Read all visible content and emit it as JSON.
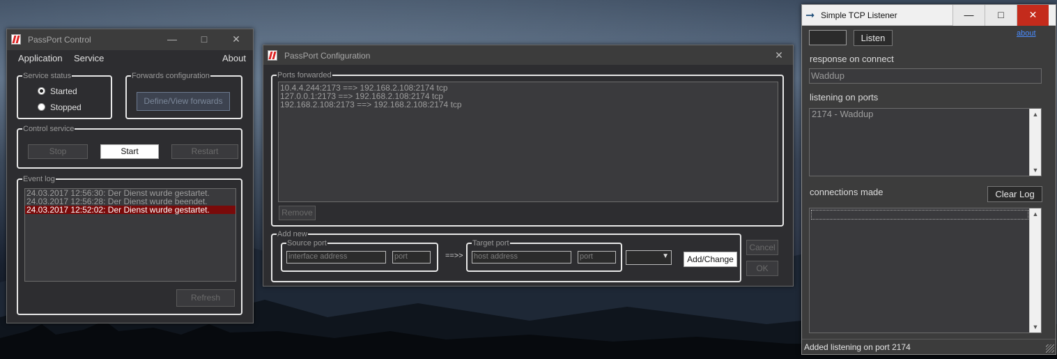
{
  "passport_control": {
    "title": "PassPort Control",
    "menu": {
      "application": "Application",
      "service": "Service",
      "about": "About"
    },
    "service_status": {
      "legend": "Service status",
      "started": "Started",
      "stopped": "Stopped",
      "selected": "Started"
    },
    "forwards_configuration": {
      "legend": "Forwards configuration",
      "button": "Define/View forwards"
    },
    "control_service": {
      "legend": "Control service",
      "stop": "Stop",
      "start": "Start",
      "restart": "Restart"
    },
    "event_log": {
      "legend": "Event log",
      "entries": [
        "24.03.2017 12:56:30:  Der Dienst wurde gestartet.",
        "24.03.2017 12:56:28:  Der Dienst wurde beendet.",
        "24.03.2017 12:52:02:  Der Dienst wurde gestartet."
      ],
      "selected_index": 2,
      "refresh": "Refresh"
    }
  },
  "passport_configuration": {
    "title": "PassPort Configuration",
    "ports_forwarded": {
      "legend": "Ports forwarded",
      "entries": [
        "10.4.4.244:2173 ==> 192.168.2.108:2174 tcp",
        "127.0.0.1:2173 ==> 192.168.2.108:2174 tcp",
        "192.168.2.108:2173 ==> 192.168.2.108:2174 tcp"
      ],
      "remove": "Remove"
    },
    "add_new": {
      "legend": "Add new",
      "source_port_legend": "Source port",
      "source_address_placeholder": "interface address",
      "source_port_placeholder": "port",
      "arrow": "==>>",
      "target_port_legend": "Target port",
      "target_address_placeholder": "host address",
      "target_port_placeholder": "port",
      "protocol_value": "",
      "add_change": "Add/Change"
    },
    "cancel": "Cancel",
    "ok": "OK"
  },
  "tcp_listener": {
    "title": "Simple TCP Listener",
    "port_value": "",
    "listen": "Listen",
    "about": "about",
    "response_label": "response on connect",
    "response_value": "Waddup",
    "listening_label": "listening on ports",
    "listening_entries": [
      "2174 - Waddup"
    ],
    "connections_label": "connections made",
    "clear_log": "Clear Log",
    "status": "Added listening on port 2174"
  },
  "colors": {
    "selection_red": "#7a0a0a",
    "close_red": "#c42b1c",
    "link_blue": "#4a8cff"
  }
}
